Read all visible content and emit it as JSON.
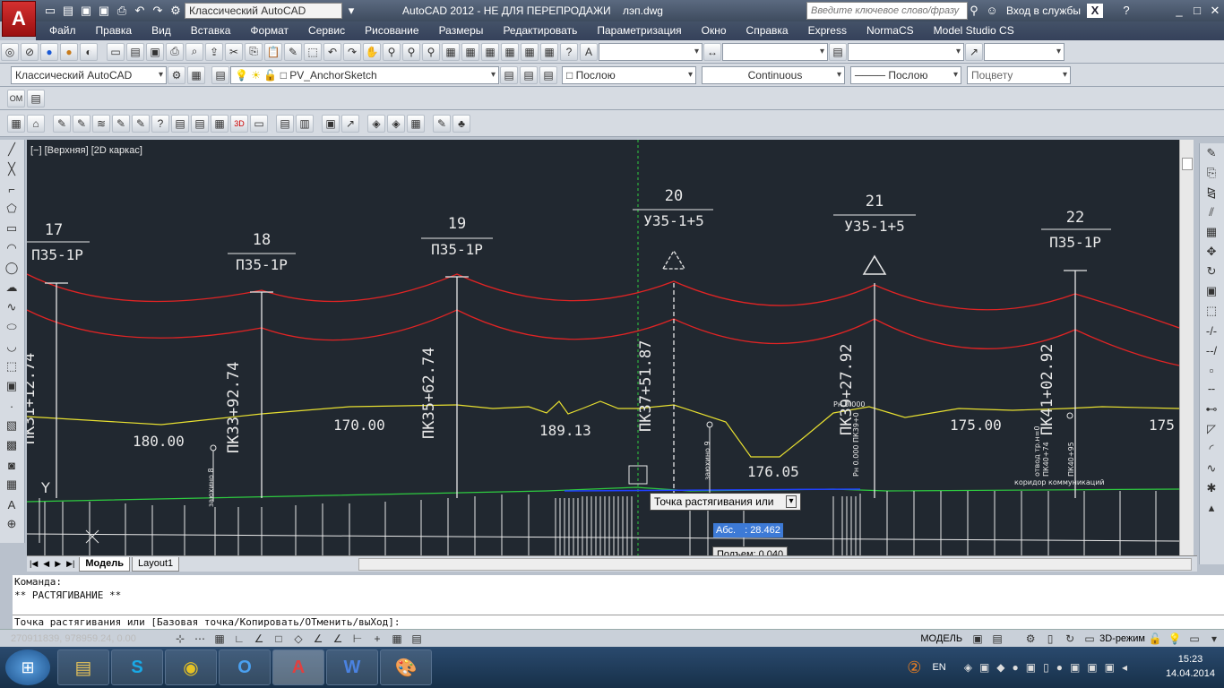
{
  "title_bar": {
    "workspace": "Классический AutoCAD",
    "title": "AutoCAD 2012 - НЕ ДЛЯ ПЕРЕПРОДАЖИ",
    "filename": "лэп.dwg",
    "search_placeholder": "Введите ключевое слово/фразу",
    "signin": "Вход в службы",
    "app_letter": "A"
  },
  "menu": [
    "Файл",
    "Правка",
    "Вид",
    "Вставка",
    "Формат",
    "Сервис",
    "Рисование",
    "Размеры",
    "Редактировать",
    "Параметризация",
    "Окно",
    "Справка",
    "Express",
    "NormaCS",
    "Model Studio CS"
  ],
  "layer_bar": {
    "workspace": "Классический AutoCAD",
    "layer": "PV_AnchorSketch",
    "color": "Послою",
    "linetype": "Continuous",
    "lineweight": "Послою",
    "plotstyle": "Поцвету"
  },
  "viewport_label": "[−] [Верхняя] [2D каркас]",
  "drawing": {
    "poles": [
      {
        "num": "17",
        "type": "П35-1Р",
        "pk": "ПК31+12.74"
      },
      {
        "num": "18",
        "type": "П35-1Р",
        "pk": "ПК33+92.74"
      },
      {
        "num": "19",
        "type": "П35-1Р",
        "pk": "ПК35+62.74"
      },
      {
        "num": "20",
        "type": "У35-1+5",
        "pk": "ПК37+51.87"
      },
      {
        "num": "21",
        "type": "У35-1+5",
        "pk": "ПК39+27.92"
      },
      {
        "num": "22",
        "type": "П35-1Р",
        "pk": "ПК41+02.92"
      }
    ],
    "spans": [
      "180.00",
      "170.00",
      "189.13",
      "176.05",
      "175.00",
      "175"
    ],
    "small_labels": [
      "заюхино 8",
      "заюхино 9",
      "отвод тр.н=0",
      "ПК40+74",
      "ПК40+95",
      "коридор коммуникаций",
      "Рн 0.000",
      "Рн 0.000 ПК39+0"
    ],
    "axis_y": "Y"
  },
  "grip_prompt": "Точка растягивания или",
  "abs_label": "Абс.",
  "abs_value": ": 28.462",
  "rise_label": "Подъем: 0.040",
  "tabs": [
    "Модель",
    "Layout1"
  ],
  "command_lines": [
    "Команда:",
    "** РАСТЯГИВАНИЕ **",
    "",
    "Точка растягивания или [Базовая точка/Копировать/ОТменить/выХод]:"
  ],
  "status": {
    "coords": "270911839, 978959.24, 0.00",
    "model": "МОДЕЛЬ",
    "mode3d": "3D-режим"
  },
  "taskbar": {
    "lang": "EN",
    "time": "15:23",
    "date": "14.04.2014"
  }
}
